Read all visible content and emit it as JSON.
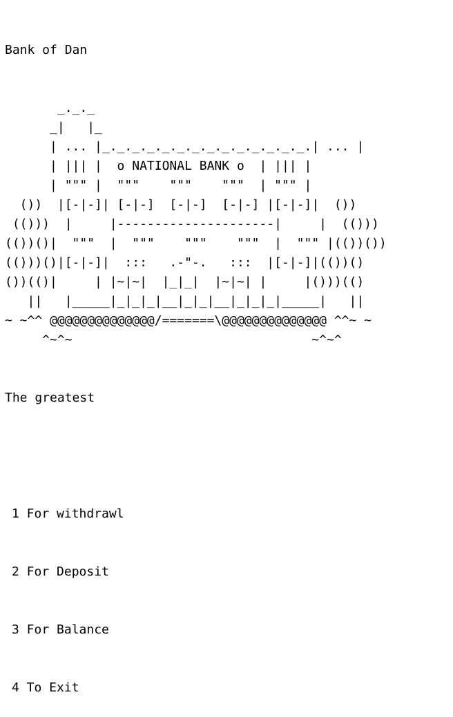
{
  "terminal": {
    "header": "Bank of Dan",
    "ascii_art": "       _._._       \n      _|   |_      \n      | ... |_._._._._._._._._._._._._._.| ... |\n      | ||| |  o NATIONAL BANK o  | ||| |\n      | \"\"\" |  \"\"\"    \"\"\"    \"\"\"  | \"\"\" |\n  ())  |[-|-]| [-|-]  [-|-]  [-|-] |[-|-]|  ())\n (()))  |     |---------------------|     |  (()))\n(())()|  \"\"\"  |  \"\"\"    \"\"\"    \"\"\"  |  \"\"\" |(())())\n(()))()|[-|-]|  :::   .-\"-.   :::  |[-|-]|(())()\n())(()|     | |~|~|  |_|_|  |~|~| |     |()))(()\n   ||   |_____|_|_|_|__|_|_|__|_|_|_|_____|   ||\n~ ~^^ @@@@@@@@@@@@@@/=======\\@@@@@@@@@@@@@@ ^^~ ~\n     ^~^~                                ~^~^",
    "tagline": "The greatest",
    "menu": [
      "1 For withdrawl",
      "2 For Deposit",
      "3 For Balance",
      "4 To Exit"
    ]
  }
}
